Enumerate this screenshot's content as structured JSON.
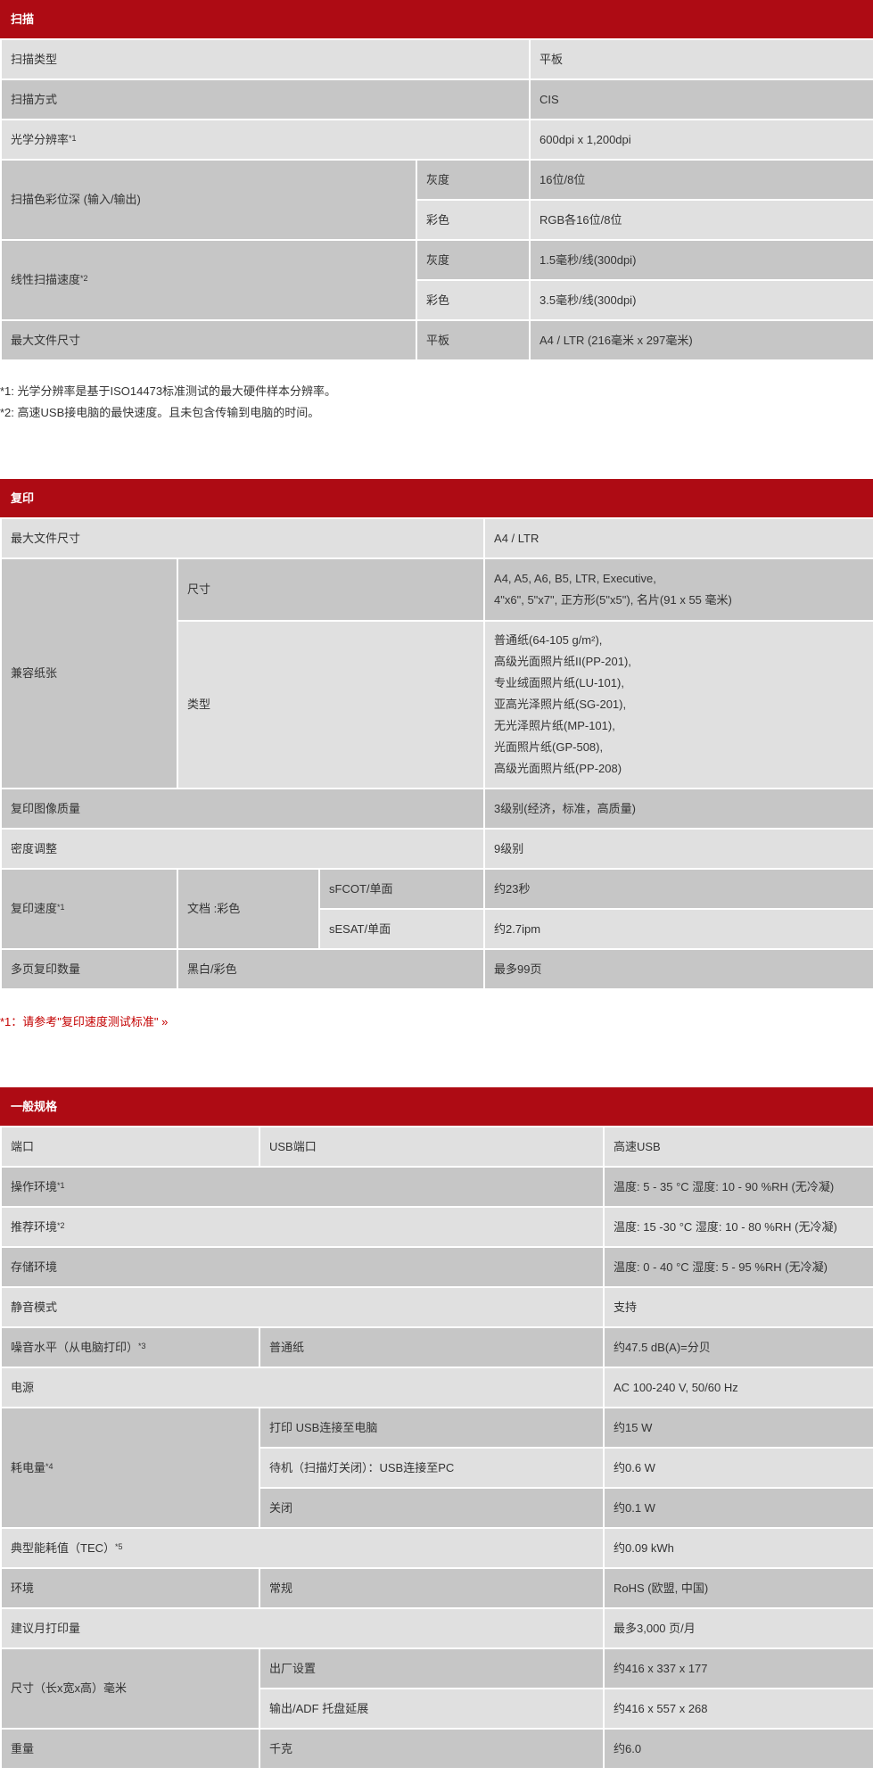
{
  "scan": {
    "title": "扫描",
    "rows": {
      "type_label": "扫描类型",
      "type_value": "平板",
      "method_label": "扫描方式",
      "method_value": "CIS",
      "res_label": "光学分辨率",
      "res_sup": "*1",
      "res_value": "600dpi x 1,200dpi",
      "depth_label": "扫描色彩位深 (输入/输出)",
      "depth_gray_label": "灰度",
      "depth_gray_value": "16位/8位",
      "depth_color_label": "彩色",
      "depth_color_value": "RGB各16位/8位",
      "speed_label": "线性扫描速度",
      "speed_sup": "*2",
      "speed_gray_label": "灰度",
      "speed_gray_value": "1.5毫秒/线(300dpi)",
      "speed_color_label": "彩色",
      "speed_color_value": "3.5毫秒/线(300dpi)",
      "maxsize_label": "最大文件尺寸",
      "maxsize_sub": "平板",
      "maxsize_value": "A4 / LTR (216毫米 x 297毫米)"
    },
    "notes": [
      "*1: 光学分辨率是基于ISO14473标准测试的最大硬件样本分辨率。",
      "*2: 高速USB接电脑的最快速度。且未包含传输到电脑的时间。"
    ]
  },
  "copy": {
    "title": "复印",
    "rows": {
      "maxsize_label": "最大文件尺寸",
      "maxsize_value": "A4 / LTR",
      "paper_label": "兼容纸张",
      "paper_size_label": "尺寸",
      "paper_size_lines": [
        "A4, A5, A6, B5, LTR, Executive,",
        "4\"x6\", 5\"x7\", 正方形(5\"x5\"), 名片(91 x 55 毫米)"
      ],
      "paper_type_label": "类型",
      "paper_type_lines": [
        "普通纸(64-105 g/m²),",
        "高级光面照片纸II(PP-201),",
        "专业绒面照片纸(LU-101),",
        "亚高光泽照片纸(SG-201),",
        "无光泽照片纸(MP-101),",
        "光面照片纸(GP-508),",
        "高级光面照片纸(PP-208)"
      ],
      "quality_label": "复印图像质量",
      "quality_value": "3级别(经济，标准，高质量)",
      "density_label": "密度调整",
      "density_value": "9级别",
      "speed_label": "复印速度",
      "speed_sup": "*1",
      "speed_doc": "文档 :彩色",
      "speed_fcot_label": "sFCOT/单面",
      "speed_fcot_value": "约23秒",
      "speed_esat_label": "sESAT/单面",
      "speed_esat_value": "约2.7ipm",
      "multi_label": "多页复印数量",
      "multi_sub": "黑白/彩色",
      "multi_value": "最多99页"
    },
    "note": "*1：请参考\"复印速度测试标准\" »"
  },
  "general": {
    "title": "一般规格",
    "rows": {
      "port_label": "端口",
      "port_sub": "USB端口",
      "port_value": "高速USB",
      "op_env_label": "操作环境",
      "op_env_sup": "*1",
      "op_env_value": "温度: 5 - 35 °C 湿度: 10 - 90 %RH (无冷凝)",
      "rec_env_label": "推荐环境",
      "rec_env_sup": "*2",
      "rec_env_value": "温度: 15 -30 °C 湿度: 10 - 80 %RH (无冷凝)",
      "store_env_label": "存储环境",
      "store_env_value": "温度: 0 - 40 °C 湿度: 5 - 95 %RH (无冷凝)",
      "quiet_label": "静音模式",
      "quiet_value": "支持",
      "noise_label": "噪音水平（从电脑打印）",
      "noise_sup": "*3",
      "noise_sub": "普通纸",
      "noise_value": "约47.5 dB(A)=分贝",
      "power_label": "电源",
      "power_value": "AC 100-240 V, 50/60 Hz",
      "consume_label": "耗电量",
      "consume_sup": "*4",
      "consume_print_label": "打印 USB连接至电脑",
      "consume_print_value": "约15 W",
      "consume_standby_label": "待机（扫描灯关闭）：USB连接至PC",
      "consume_standby_value": "约0.6 W",
      "consume_off_label": "关闭",
      "consume_off_value": "约0.1 W",
      "tec_label": "典型能耗值（TEC）",
      "tec_sup": "*5",
      "tec_value": "约0.09 kWh",
      "environment_label": "环境",
      "environment_sub": "常规",
      "environment_value": "RoHS (欧盟, 中国)",
      "monthly_label": "建议月打印量",
      "monthly_value": "最多3,000 页/月",
      "dim_label": "尺寸（长x宽x高）毫米",
      "dim_factory_label": "出厂设置",
      "dim_factory_value": "约416 x 337 x 177",
      "dim_output_label": "输出/ADF 托盘延展",
      "dim_output_value": "约416 x 557 x 268",
      "weight_label": "重量",
      "weight_sub": "千克",
      "weight_value": "约6.0"
    }
  }
}
